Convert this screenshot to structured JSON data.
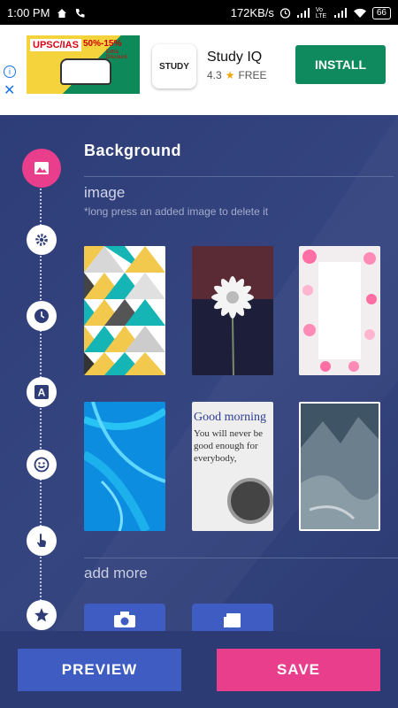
{
  "status": {
    "time": "1:00 PM",
    "speed": "172KB/s",
    "battery": "66",
    "network_label": "Vo LTE"
  },
  "ad": {
    "banner_text": "UPSC/IAS",
    "banner_discount": "50%-15%",
    "banner_extra": "Extra Discount",
    "app_logo_text": "STUDY",
    "app_name": "Study IQ",
    "rating": "4.3",
    "price": "FREE",
    "install_label": "INSTALL"
  },
  "panel": {
    "title": "Background",
    "subtitle": "image",
    "hint": "*long press an added image to delete it",
    "add_more": "add more"
  },
  "thumbnails": [
    {
      "name": "geometric-triangles",
      "colors": [
        "#f2c94c",
        "#16b5b5",
        "#ffffff"
      ]
    },
    {
      "name": "daisy-flower",
      "colors": [
        "#1d1f3a",
        "#ffffff"
      ]
    },
    {
      "name": "rose-petals",
      "colors": [
        "#f4e6ea",
        "#ff6fa3"
      ]
    },
    {
      "name": "blue-abstract",
      "colors": [
        "#0d8de0",
        "#27c3f5"
      ]
    },
    {
      "name": "good-morning-quote",
      "colors": [
        "#eeeeee",
        "#2a3b8f"
      ]
    },
    {
      "name": "mountain-landscape",
      "colors": [
        "#4b6070",
        "#8a9ca6"
      ]
    }
  ],
  "quote": {
    "line1": "Good morning",
    "line2": "You will never be",
    "line3": "good enough for",
    "line4": "everybody,"
  },
  "buttons": {
    "preview": "PREVIEW",
    "save": "SAVE"
  },
  "colors": {
    "accent_pink": "#e83e8c",
    "accent_blue": "#3e5cc2",
    "panel_bg": "#2e3d77",
    "install_green": "#0f8a5f"
  },
  "timeline_icons": [
    "image-icon",
    "gear-icon",
    "clock-icon",
    "text-icon",
    "emoji-icon",
    "touch-icon",
    "star-icon"
  ]
}
